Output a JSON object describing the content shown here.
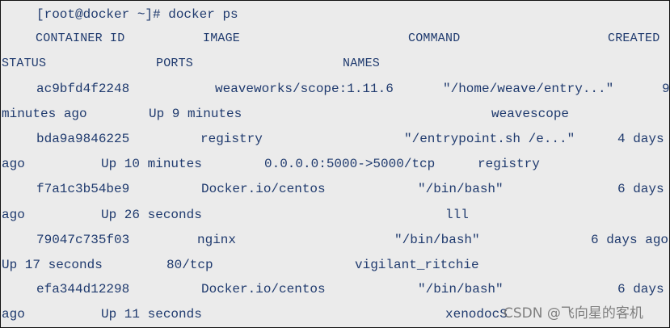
{
  "terminal": {
    "prompt": "[root@docker ~]# docker ps",
    "header": {
      "container_id": "CONTAINER ID",
      "image": "IMAGE",
      "command": "COMMAND",
      "created": "CREATED",
      "status": "STATUS",
      "ports": "PORTS",
      "names": "NAMES"
    },
    "rows": [
      {
        "id": "ac9bfd4f2248",
        "image": "weaveworks/scope:1.11.6",
        "command": "\"/home/weave/entry...\"",
        "created_a": "9",
        "created_b": "minutes ago",
        "status": "Up 9 minutes",
        "ports": "",
        "names": "weavescope"
      },
      {
        "id": "bda9a9846225",
        "image": "registry",
        "command": "\"/entrypoint.sh /e...\"",
        "created_a": "4 days",
        "created_b": "ago",
        "status": "Up 10 minutes",
        "ports": "0.0.0.0:5000->5000/tcp",
        "names": "registry"
      },
      {
        "id": "f7a1c3b54be9",
        "image": "Docker.io/centos",
        "command": "\"/bin/bash\"",
        "created_a": "6 days",
        "created_b": "ago",
        "status": "Up 26 seconds",
        "ports": "",
        "names": "lll"
      },
      {
        "id": "79047c735f03",
        "image": "nginx",
        "command": "\"/bin/bash\"",
        "created_a": "6 days ago",
        "created_b": "",
        "status": "Up 17 seconds",
        "ports": "80/tcp",
        "names": "vigilant_ritchie"
      },
      {
        "id": "efa344d12298",
        "image": "Docker.io/centos",
        "command": "\"/bin/bash\"",
        "created_a": "6 days",
        "created_b": "ago",
        "status": "Up 11 seconds",
        "ports": "",
        "names": "xenodocS"
      }
    ]
  },
  "watermark": "CSDN @飞向星的客机",
  "colors": {
    "text": "#1f3a6e",
    "background": "#ebebeb",
    "border": "#111111",
    "watermark": "#6d6d6d"
  }
}
